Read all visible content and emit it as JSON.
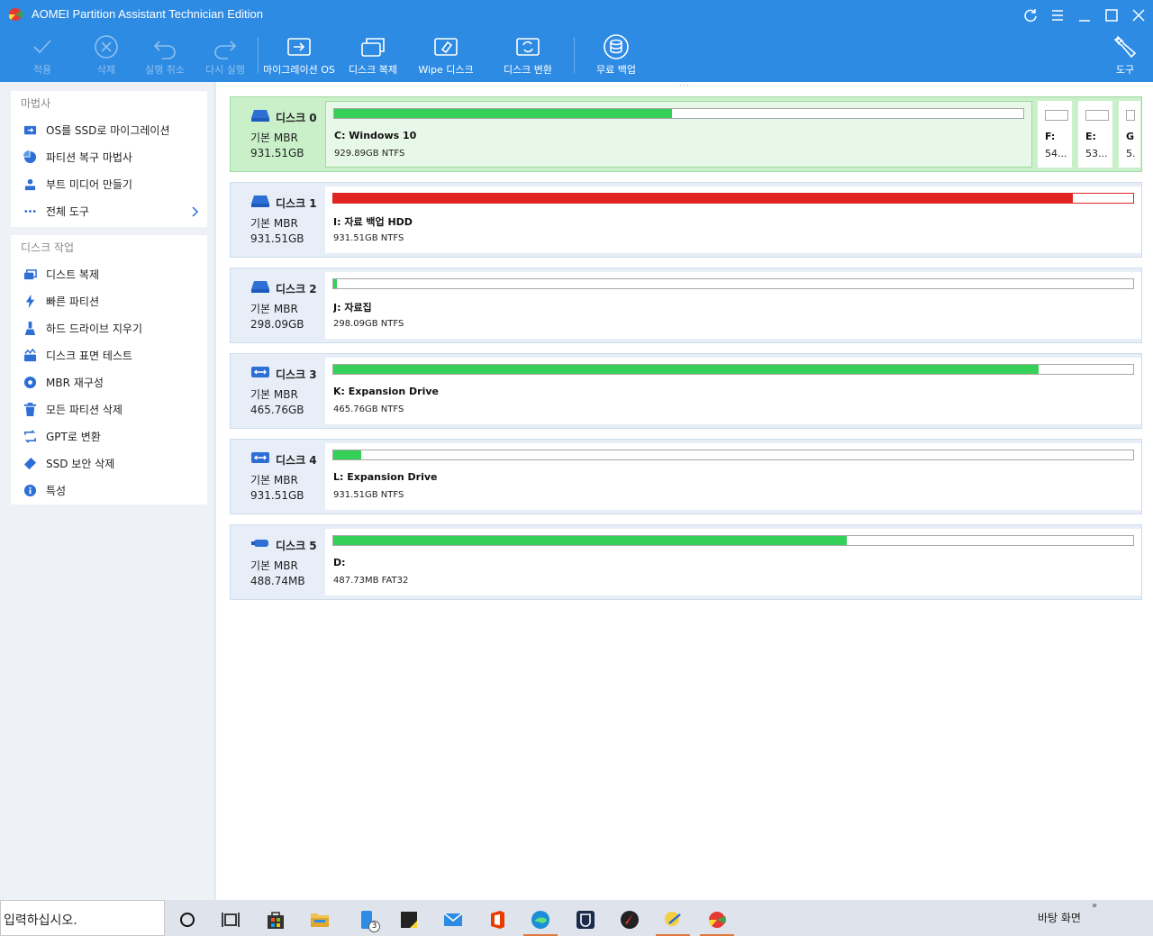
{
  "window": {
    "title": "AOMEI Partition Assistant Technician Edition",
    "controls": [
      "refresh-icon",
      "menu-icon",
      "minimize-icon",
      "maximize-icon",
      "close-icon"
    ]
  },
  "toolbar": {
    "apply": "적용",
    "delete": "삭제",
    "undo": "실행 취소",
    "redo": "다시 실행",
    "migrate_os": "마이그레이션 OS",
    "disk_clone": "디스크 복제",
    "wipe_disk": "Wipe 디스크",
    "disk_convert": "디스크 변환",
    "free_backup": "무료 백업",
    "tools": "도구"
  },
  "sidebar": {
    "wizard_title": "마법사",
    "wizard_items": [
      {
        "label": "OS를 SSD로 마이그레이션",
        "icon": "migrate-icon"
      },
      {
        "label": "파티션 복구 마법사",
        "icon": "recovery-icon"
      },
      {
        "label": "부트 미디어 만들기",
        "icon": "boot-media-icon"
      },
      {
        "label": "전체 도구",
        "icon": "more-icon"
      }
    ],
    "disk_ops_title": "디스크 작업",
    "disk_ops_items": [
      {
        "label": "디스트 복제",
        "icon": "disk-clone-icon"
      },
      {
        "label": "빠른 파티션",
        "icon": "lightning-icon"
      },
      {
        "label": "하드 드라이브 지우기",
        "icon": "wipe-icon"
      },
      {
        "label": "디스크 표면 테스트",
        "icon": "surface-test-icon"
      },
      {
        "label": "MBR 재구성",
        "icon": "rebuild-mbr-icon"
      },
      {
        "label": "모든 파티션 삭제",
        "icon": "trash-icon"
      },
      {
        "label": "GPT로 변환",
        "icon": "convert-icon"
      },
      {
        "label": "SSD 보안 삭제",
        "icon": "eraser-icon"
      },
      {
        "label": "특성",
        "icon": "info-icon"
      }
    ]
  },
  "disks": [
    {
      "name": "디스크 0",
      "type": "기본 MBR",
      "size": "931.51GB",
      "selected": true,
      "icon": "hdd-icon",
      "partitions": [
        {
          "name": "C: Windows 10",
          "detail": "929.89GB NTFS",
          "used": 0.49,
          "color": "#34d058"
        },
        {
          "name": "F:",
          "detail": "54...",
          "used": 0.0,
          "color": "#34d058"
        },
        {
          "name": "E:",
          "detail": "53...",
          "used": 0.0,
          "color": "#34d058"
        },
        {
          "name": "G",
          "detail": "5.",
          "used": 0.0,
          "color": "#34d058"
        }
      ]
    },
    {
      "name": "디스크 1",
      "type": "기본 MBR",
      "size": "931.51GB",
      "selected": false,
      "icon": "hdd-icon",
      "partitions": [
        {
          "name": "I: 자료 백업 HDD",
          "detail": "931.51GB NTFS",
          "used": 0.924,
          "color": "#e02424"
        }
      ]
    },
    {
      "name": "디스크 2",
      "type": "기본 MBR",
      "size": "298.09GB",
      "selected": false,
      "icon": "hdd-icon",
      "partitions": [
        {
          "name": "J: 자료집",
          "detail": "298.09GB NTFS",
          "used": 0.004,
          "color": "#34d058"
        }
      ]
    },
    {
      "name": "디스크 3",
      "type": "기본 MBR",
      "size": "465.76GB",
      "selected": false,
      "icon": "external-drive-icon",
      "partitions": [
        {
          "name": "K: Expansion Drive",
          "detail": "465.76GB NTFS",
          "used": 0.882,
          "color": "#34d058"
        }
      ]
    },
    {
      "name": "디스크 4",
      "type": "기본 MBR",
      "size": "931.51GB",
      "selected": false,
      "icon": "external-drive-icon",
      "partitions": [
        {
          "name": "L: Expansion Drive",
          "detail": "931.51GB NTFS",
          "used": 0.035,
          "color": "#34d058"
        }
      ]
    },
    {
      "name": "디스크 5",
      "type": "기본 MBR",
      "size": "488.74MB",
      "selected": false,
      "icon": "usb-icon",
      "partitions": [
        {
          "name": "D:",
          "detail": "487.73MB FAT32",
          "used": 0.642,
          "color": "#34d058"
        }
      ]
    }
  ],
  "taskbar": {
    "search_placeholder": "입력하십시오.",
    "apps": [
      "cortana-icon",
      "task-view-icon",
      "store-icon",
      "file-explorer-icon",
      "phone-icon",
      "sticky-notes-icon",
      "mail-icon",
      "office-icon",
      "edge-icon",
      "bitwarden-icon",
      "app-red-icon",
      "app-yellow-icon",
      "aomei-icon"
    ],
    "phone_badge": "3",
    "desktop_label": "바탕 화면",
    "tray_chevron": "»"
  }
}
